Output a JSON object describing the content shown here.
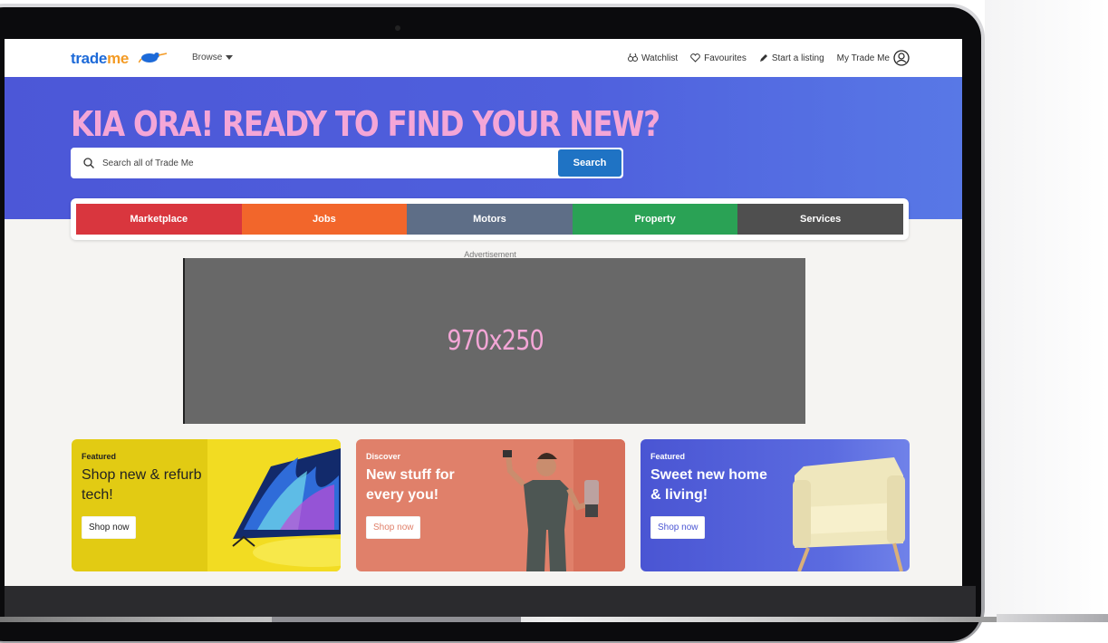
{
  "header": {
    "logo_primary": "trade",
    "logo_secondary": "me",
    "browse_label": "Browse",
    "nav": [
      {
        "label": "Watchlist",
        "icon": "binoculars-icon"
      },
      {
        "label": "Favourites",
        "icon": "heart-icon"
      },
      {
        "label": "Start a listing",
        "icon": "pencil-icon"
      },
      {
        "label": "My Trade Me",
        "icon": "user-circle-icon"
      }
    ]
  },
  "hero": {
    "headline": "KIA ORA! READY TO FIND YOUR NEW?",
    "search_placeholder": "Search all of Trade Me",
    "search_button": "Search"
  },
  "tabs": [
    {
      "label": "Marketplace",
      "color": "#d9363e"
    },
    {
      "label": "Jobs",
      "color": "#f2662b"
    },
    {
      "label": "Motors",
      "color": "#5e6e87"
    },
    {
      "label": "Property",
      "color": "#2aa255"
    },
    {
      "label": "Services",
      "color": "#4f4f4f"
    }
  ],
  "ad": {
    "label": "Advertisement",
    "size_text": "970x250"
  },
  "cards": [
    {
      "kicker": "Featured",
      "title": "Shop new & refurb tech!",
      "button": "Shop now"
    },
    {
      "kicker": "Discover",
      "title": "New stuff for every you!",
      "button": "Shop now"
    },
    {
      "kicker": "Featured",
      "title": "Sweet new home & living!",
      "button": "Shop now"
    }
  ],
  "colors": {
    "hero_bg": "#4c57d7",
    "headline": "#f4a6d7",
    "search_button": "#1f73c4"
  }
}
